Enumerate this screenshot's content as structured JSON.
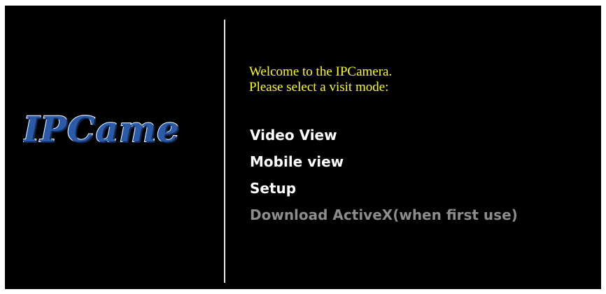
{
  "logo": {
    "text": "IPCame"
  },
  "welcome": {
    "line1": "Welcome to the IPCamera.",
    "line2": "Please select a visit mode:"
  },
  "menu": {
    "items": [
      {
        "label": "Video View",
        "enabled": true
      },
      {
        "label": "Mobile view",
        "enabled": true
      },
      {
        "label": "Setup",
        "enabled": true
      },
      {
        "label": "Download ActiveX(when first use)",
        "enabled": false
      }
    ]
  },
  "colors": {
    "background": "#000000",
    "welcome_text": "#ffff00",
    "menu_text": "#ffffff",
    "menu_disabled_text": "#8c8c8c",
    "logo_fill": "#2a5aa8"
  }
}
